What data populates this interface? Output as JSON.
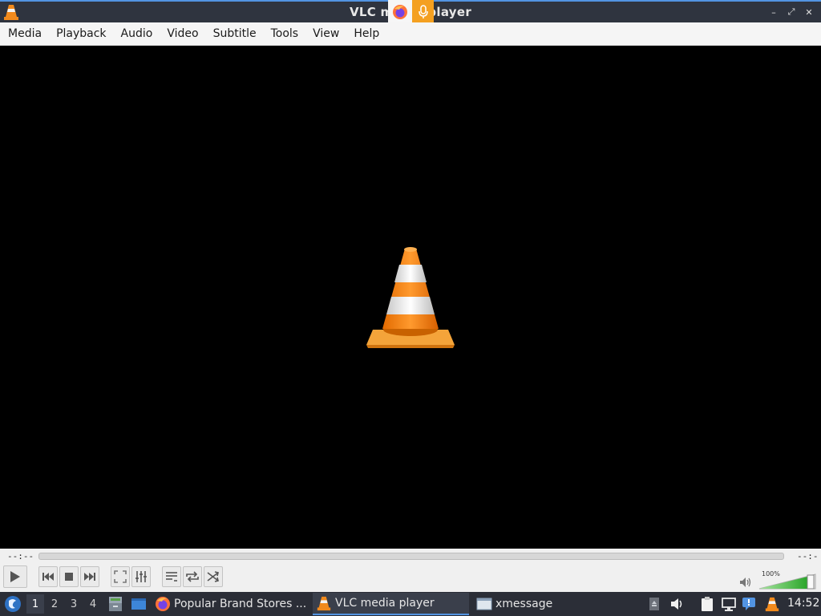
{
  "window": {
    "title": "VLC media player",
    "controls": {
      "minimize": "–",
      "maximize": "⤢",
      "close": "✕"
    }
  },
  "overlay_indicators": [
    "firefox-icon",
    "microphone-icon"
  ],
  "menubar": {
    "items": [
      "Media",
      "Playback",
      "Audio",
      "Video",
      "Subtitle",
      "Tools",
      "View",
      "Help"
    ]
  },
  "player": {
    "elapsed": "--:--",
    "remaining": "--:--",
    "seek_progress": 0,
    "volume_label": "100%",
    "volume_level": 1.0,
    "buttons": [
      "play-icon",
      "previous-icon",
      "stop-icon",
      "next-icon",
      "fullscreen-icon",
      "extended-settings-icon",
      "playlist-icon",
      "loop-icon",
      "shuffle-icon"
    ]
  },
  "taskbar": {
    "workspaces": [
      "1",
      "2",
      "3",
      "4"
    ],
    "active_workspace": "1",
    "tasks": [
      {
        "label": "Popular Brand Stores ...",
        "icon": "firefox-icon"
      },
      {
        "label": "VLC media player",
        "icon": "vlc-icon",
        "active": true
      },
      {
        "label": "xmessage",
        "icon": "window-icon"
      }
    ],
    "clock": "14:52"
  },
  "colors": {
    "accent": "#5294e2",
    "titlebar": "#2f343f",
    "taskbar": "#2b2e37",
    "cone_orange": "#f28a1c"
  }
}
